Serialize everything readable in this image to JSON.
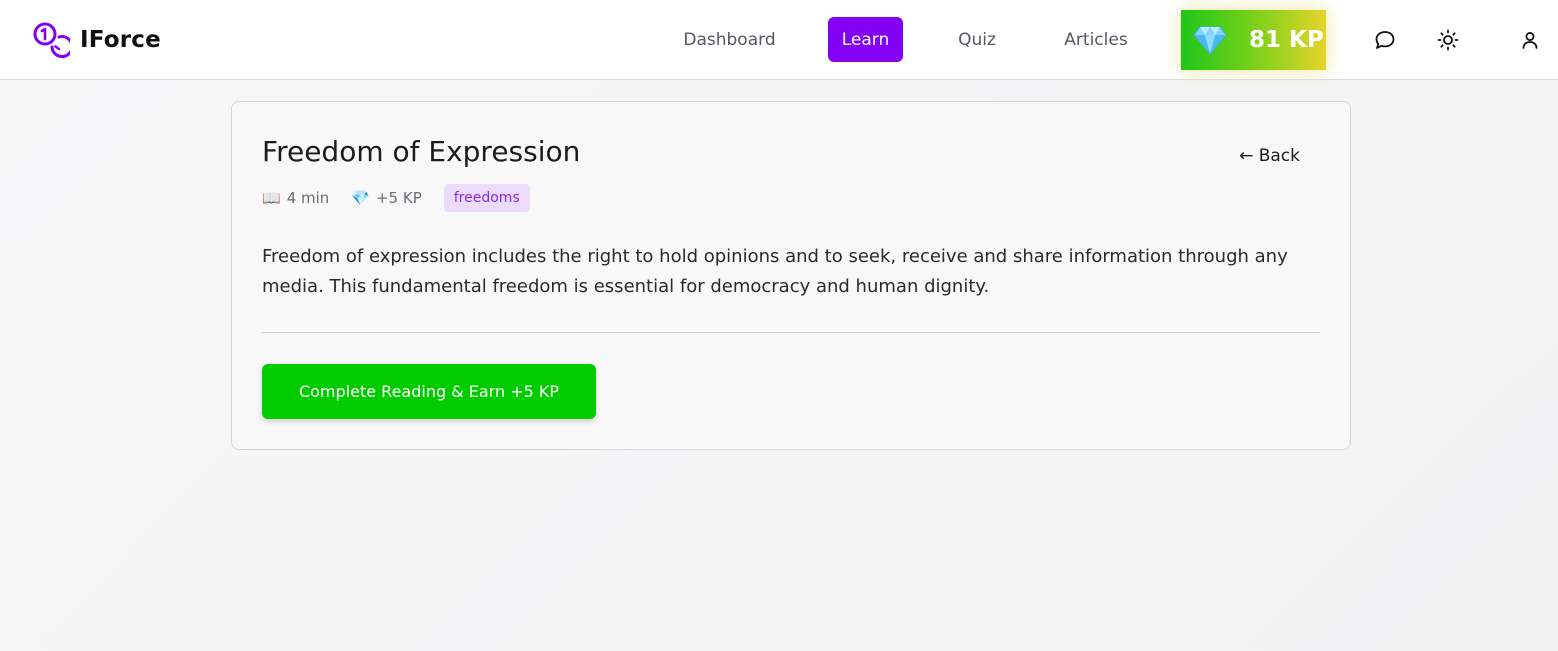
{
  "brand": {
    "name": "IForce"
  },
  "nav": {
    "links": [
      {
        "label": "Dashboard",
        "active": false
      },
      {
        "label": "Learn",
        "active": true
      },
      {
        "label": "Quiz",
        "active": false
      },
      {
        "label": "Articles",
        "active": false
      }
    ],
    "kp_badge": {
      "icon": "gem-icon",
      "value": "81 KP"
    },
    "icons": [
      "chat-icon",
      "sun-icon",
      "user-icon"
    ]
  },
  "colors": {
    "accent": "#8300f5",
    "cta_green": "#00cc00",
    "tag_bg": "#ecdcfb",
    "tag_text": "#8a2be2"
  },
  "article": {
    "title": "Freedom of Expression",
    "back_label": "← Back",
    "read_time_icon": "📖",
    "read_time": "4 min",
    "reward_icon": "💎",
    "reward": "+5 KP",
    "tag": "freedoms",
    "body": "Freedom of expression includes the right to hold opinions and to seek, receive and share information through any media. This fundamental freedom is essential for democracy and human dignity.",
    "cta_label": "Complete Reading & Earn +5 KP"
  }
}
